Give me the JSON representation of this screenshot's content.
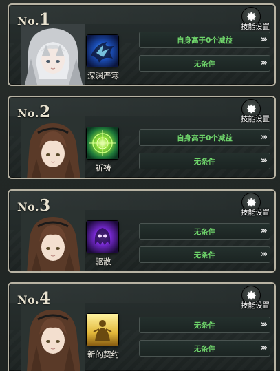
{
  "slots": [
    {
      "no_prefix": "No.",
      "no_number": "1",
      "skill_name": "深渊严寒",
      "skill_icon": "dark-ice-wing-icon",
      "conditions": [
        "自身高于0个减益",
        "无条件"
      ],
      "settings_label": "技能设置"
    },
    {
      "no_prefix": "No.",
      "no_number": "2",
      "skill_name": "祈祷",
      "skill_icon": "green-target-glow-icon",
      "conditions": [
        "自身高于0个减益",
        "无条件"
      ],
      "settings_label": "技能设置"
    },
    {
      "no_prefix": "No.",
      "no_number": "3",
      "skill_name": "驱散",
      "skill_icon": "purple-ghost-icon",
      "conditions": [
        "无条件",
        "无条件"
      ],
      "settings_label": "技能设置"
    },
    {
      "no_prefix": "No.",
      "no_number": "4",
      "skill_name": "新的契约",
      "skill_icon": "golden-figure-icon",
      "conditions": [
        "无条件",
        "无条件"
      ],
      "settings_label": "技能设置"
    }
  ],
  "colors": {
    "condition_text": "#6ed36a",
    "panel_border": "#b8b3a3"
  }
}
